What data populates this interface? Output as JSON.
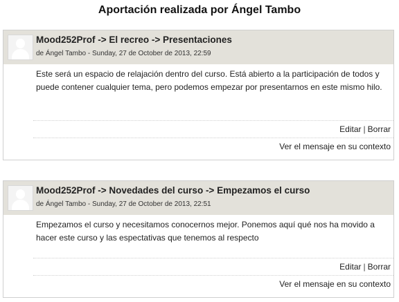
{
  "page": {
    "title": "Aportación realizada por Ángel Tambo"
  },
  "posts": [
    {
      "subject": "Mood252Prof -> El recreo -> Presentaciones",
      "author_line": "de Ángel Tambo - Sunday, 27 de October de 2013, 22:59",
      "message": "Este será un espacio de relajación dentro del curso. Está abierto a la participación de todos y puede contener cualquier tema, pero podemos empezar por presentarnos en este mismo hilo.",
      "edit_label": "Editar",
      "separator": "|",
      "delete_label": "Borrar",
      "context_link": "Ver el mensaje en su contexto"
    },
    {
      "subject": "Mood252Prof -> Novedades del curso -> Empezamos el curso",
      "author_line": "de Ángel Tambo - Sunday, 27 de October de 2013, 22:51",
      "message": "Empezamos el curso y necesitamos conocernos mejor. Ponemos aquí qué nos ha movido a hacer este curso y las espectativas que tenemos al respecto",
      "edit_label": "Editar",
      "separator": "|",
      "delete_label": "Borrar",
      "context_link": "Ver el mensaje en su contexto"
    }
  ],
  "icons": {
    "avatar": "user-avatar-icon"
  },
  "colors": {
    "header_bg": "#e3e1da",
    "border": "#cfcfcf"
  }
}
